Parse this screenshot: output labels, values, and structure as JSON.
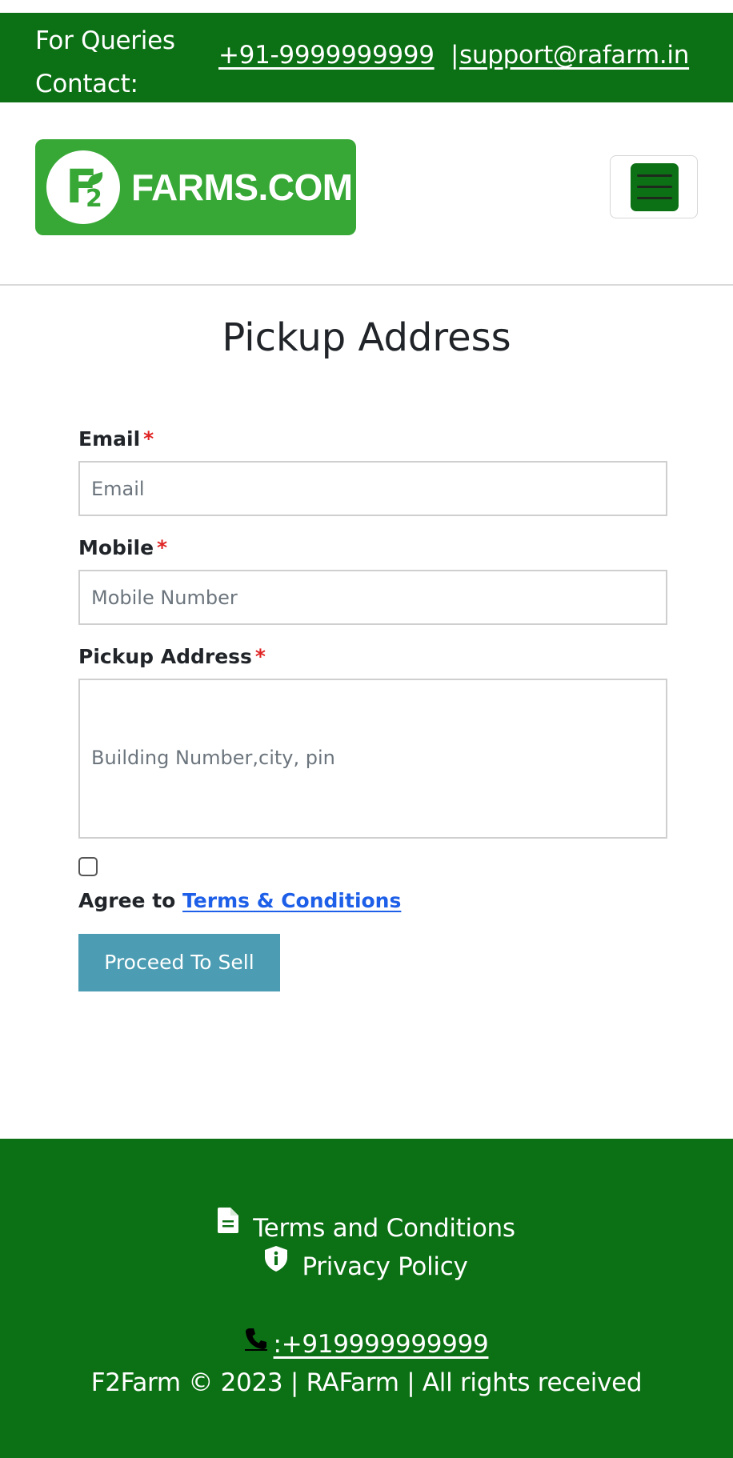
{
  "topbar": {
    "label": "For Queries Contact:",
    "phone": "+91-9999999999",
    "separator": "|",
    "email": "support@rafarm.in"
  },
  "header": {
    "logo_mark": "F",
    "logo_mark_sub": "2",
    "logo_text": "FARMS.COM",
    "menu_icon": "hamburger-icon"
  },
  "form": {
    "title": "Pickup Address",
    "required_mark": "*",
    "email": {
      "label": "Email",
      "placeholder": "Email",
      "value": ""
    },
    "mobile": {
      "label": "Mobile",
      "placeholder": "Mobile Number",
      "value": ""
    },
    "address": {
      "label": "Pickup Address",
      "placeholder": "Building Number,city, pin",
      "value": ""
    },
    "agree_prefix": "Agree to",
    "terms_link": "Terms & Conditions",
    "submit": "Proceed To Sell"
  },
  "footer": {
    "terms": "Terms and Conditions",
    "privacy": "Privacy Policy",
    "phone": ":+919999999999",
    "copyright": "F2Farm © 2023 | RAFarm | All rights received",
    "icons": [
      "document-icon",
      "shield-info-icon",
      "phone-icon"
    ]
  },
  "colors": {
    "brand_green": "#0c7014",
    "logo_green": "#37a836",
    "button_teal": "#4c9db3",
    "link_blue": "#1d5fe8",
    "required_red": "#e02424"
  }
}
